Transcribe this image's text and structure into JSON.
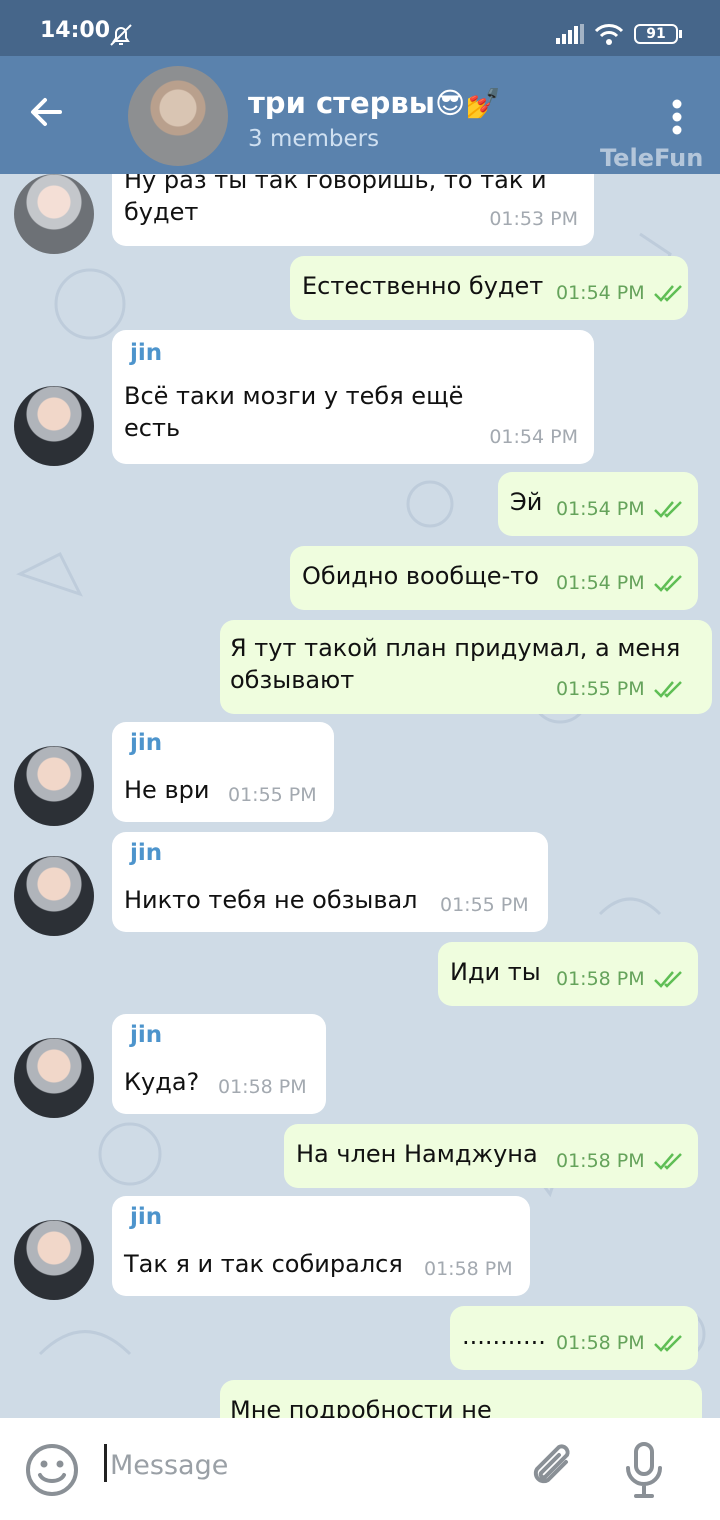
{
  "status_bar": {
    "time": "14:00",
    "battery": "91"
  },
  "header": {
    "title": "три стервы😎💅",
    "subtitle": "3 members",
    "watermark": "TeleFun"
  },
  "messages": [
    {
      "direction": "in",
      "sender": "",
      "text": "Ну раз ты так говоришь, то так и\nбудет",
      "time": "01:53 PM"
    },
    {
      "direction": "out",
      "text": "Естественно будет",
      "time": "01:54 PM"
    },
    {
      "direction": "in",
      "sender": "jin",
      "text": "Всё таки мозги у тебя ещё\nесть",
      "time": "01:54 PM"
    },
    {
      "direction": "out",
      "text": "Эй",
      "time": "01:54 PM"
    },
    {
      "direction": "out",
      "text": "Обидно вообще-то",
      "time": "01:54 PM"
    },
    {
      "direction": "out",
      "text": "Я тут такой план придумал, а меня\nобзывают",
      "time": "01:55 PM"
    },
    {
      "direction": "in",
      "sender": "jin",
      "text": "Не ври",
      "time": "01:55 PM"
    },
    {
      "direction": "in",
      "sender": "jin",
      "text": "Никто тебя не обзывал",
      "time": "01:55 PM"
    },
    {
      "direction": "out",
      "text": "Иди ты",
      "time": "01:58 PM"
    },
    {
      "direction": "in",
      "sender": "jin",
      "text": "Куда?",
      "time": "01:58 PM"
    },
    {
      "direction": "out",
      "text": "На член Намджуна",
      "time": "01:58 PM"
    },
    {
      "direction": "in",
      "sender": "jin",
      "text": "Так я и так собирался",
      "time": "01:58 PM"
    },
    {
      "direction": "out",
      "text": "...........",
      "time": "01:58 PM"
    },
    {
      "direction": "out",
      "text": "Мне подробности не",
      "time": ""
    }
  ],
  "input": {
    "placeholder": "Message"
  },
  "icons": {
    "back": "arrow-left-icon",
    "menu": "more-vert-icon",
    "emoji": "emoji-icon",
    "attach": "paperclip-icon",
    "mic": "microphone-icon",
    "read": "double-check-icon"
  },
  "colors": {
    "header": "#5a82ad",
    "status_bar": "#46668a",
    "chat_bg": "#cfdbe6",
    "incoming_bubble": "#ffffff",
    "outgoing_bubble": "#effdde",
    "sender_name": "#4d94cc",
    "outgoing_time": "#65a35b"
  }
}
